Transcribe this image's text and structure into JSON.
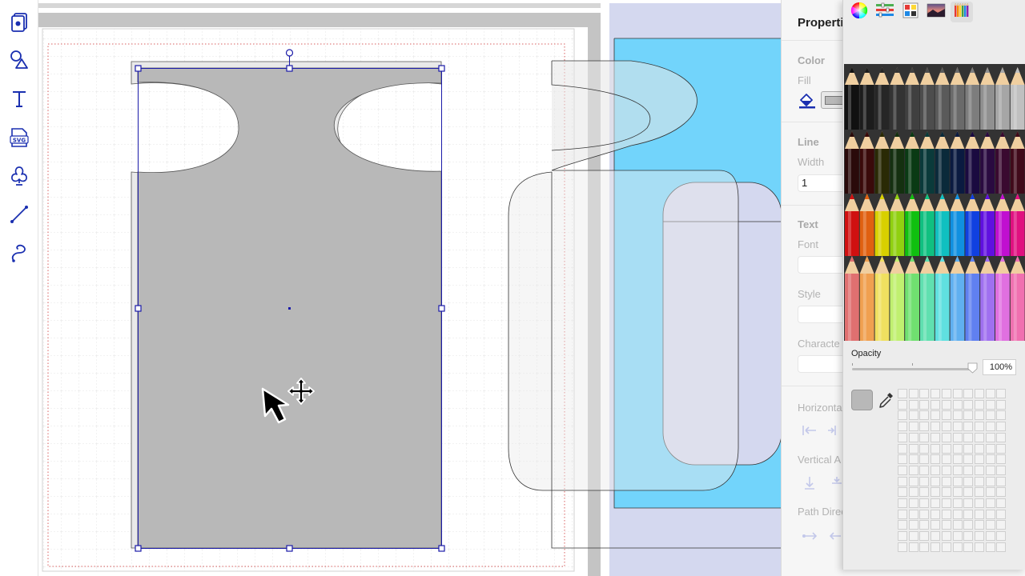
{
  "toolbar": {
    "items": [
      {
        "icon": "pages-icon"
      },
      {
        "icon": "shapes-icon"
      },
      {
        "icon": "text-tool-icon",
        "glyph": "T"
      },
      {
        "icon": "svg-import-icon",
        "glyph": "SVG"
      },
      {
        "icon": "club-shape-icon"
      },
      {
        "icon": "line-tool-icon"
      },
      {
        "icon": "freehand-tool-icon"
      }
    ]
  },
  "properties": {
    "title": "Properti",
    "color_section": "Color",
    "fill_label": "Fill",
    "line_section": "Line",
    "width_label": "Width",
    "width_value": "1",
    "text_section": "Text",
    "font_label": "Font",
    "style_label": "Style",
    "character_label": "Characte",
    "horizontal_label": "Horizonta",
    "vertical_label": "Vertical A",
    "path_direction_label": "Path Direc"
  },
  "color_picker": {
    "tabs": [
      "color-wheel-icon",
      "color-sliders-icon",
      "color-palettes-icon",
      "image-palette-icon",
      "pencils-icon"
    ],
    "active_tab": "pencils-icon",
    "opacity_label": "Opacity",
    "opacity_value": "100%",
    "opacity_level": 1.0,
    "current_color": "#b8b8b8"
  },
  "colors": {
    "selection": "#1a1aa8",
    "shape_fill": "#b8b8b8",
    "blue_shape": "#72d4fb",
    "lavender": "#d4d8ef",
    "grid": "#e0e0e0",
    "margin_dots": "#d96060"
  }
}
